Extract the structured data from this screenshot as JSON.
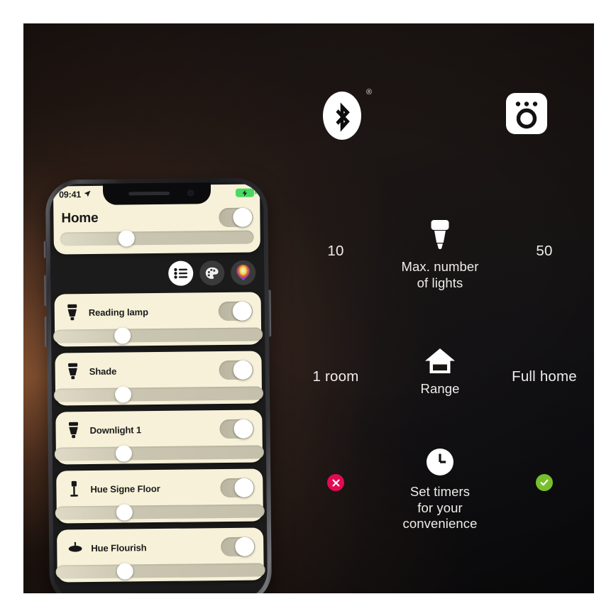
{
  "background": {
    "glow_color": "#c47848",
    "base_color": "#121215"
  },
  "comparison": {
    "hero": {
      "left_icon": "bluetooth-icon",
      "left_icon_registered_mark": "®",
      "right_icon": "hue-bridge-icon"
    },
    "rows": [
      {
        "left_value": "10",
        "icon": "light-bulb-icon",
        "caption": "Max. number of lights",
        "caption_lines": [
          "Max. number",
          "of lights"
        ],
        "right_value": "50"
      },
      {
        "left_value": "1 room",
        "icon": "house-icon",
        "caption": "Range",
        "caption_lines": [
          "Range"
        ],
        "right_value": "Full home"
      },
      {
        "left_value": "",
        "left_badge": "cross-badge",
        "icon": "clock-icon",
        "caption": "Set timers for your convenience",
        "caption_lines": [
          "Set timers",
          "for your",
          "convenience"
        ],
        "right_value": "",
        "right_badge": "check-badge"
      }
    ],
    "badge_colors": {
      "cross": "#e30a54",
      "check": "#77bf2d"
    }
  },
  "phone": {
    "status_bar": {
      "time": "09:41",
      "location_icon": "location-arrow-icon",
      "battery_icon": "battery-charging-icon",
      "battery_color": "#49d860"
    },
    "home_card": {
      "title": "Home",
      "toggle_state": "on",
      "brightness_percent": 32
    },
    "mode_buttons": [
      {
        "name": "list-view-button",
        "icon": "list-icon",
        "active": true
      },
      {
        "name": "scenes-button",
        "icon": "palette-icon",
        "active": false
      },
      {
        "name": "color-picker-button",
        "icon": "color-drop-icon",
        "active": false
      }
    ],
    "lights": [
      {
        "name": "Reading lamp",
        "icon": "bulb-spot-icon",
        "toggle_state": "on",
        "brightness_percent": 32
      },
      {
        "name": "Shade",
        "icon": "bulb-spot-icon",
        "toggle_state": "on",
        "brightness_percent": 32
      },
      {
        "name": "Downlight 1",
        "icon": "bulb-spot-icon",
        "toggle_state": "on",
        "brightness_percent": 32
      },
      {
        "name": "Hue Signe Floor",
        "icon": "floor-lamp-icon",
        "toggle_state": "on",
        "brightness_percent": 32
      },
      {
        "name": "Hue Flourish",
        "icon": "ceiling-lamp-icon",
        "toggle_state": "on",
        "brightness_percent": 32
      }
    ]
  }
}
